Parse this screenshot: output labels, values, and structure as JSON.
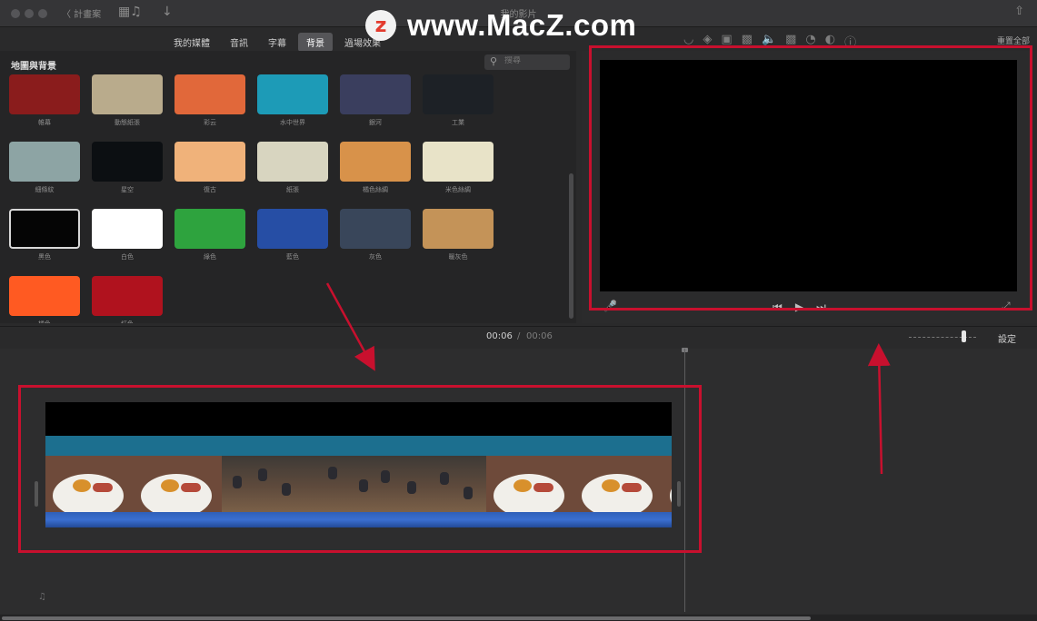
{
  "window": {
    "title": "我的影片",
    "back_label": "〈 計畫案"
  },
  "watermark": {
    "logo_letter": "z",
    "text": "www.MacZ.com"
  },
  "tabs": [
    {
      "label": "我的媒體",
      "active": false
    },
    {
      "label": "音訊",
      "active": false
    },
    {
      "label": "字幕",
      "active": false
    },
    {
      "label": "背景",
      "active": true
    },
    {
      "label": "過場效果",
      "active": false
    }
  ],
  "toolbar": {
    "reset_all": "重置全部"
  },
  "library": {
    "title": "地圖與背景",
    "search_placeholder": "搜尋",
    "items": [
      {
        "label": "帷幕",
        "color": "#8a1c1c"
      },
      {
        "label": "動態紙張",
        "color": "#b9ab8c"
      },
      {
        "label": "彩云",
        "color": "#e1683a"
      },
      {
        "label": "水中世界",
        "color": "#1d9bb7"
      },
      {
        "label": "銀河",
        "color": "#3a3e5e"
      },
      {
        "label": "工業",
        "color": "#1d2126"
      },
      {
        "label": "細條紋",
        "color": "#8da4a4"
      },
      {
        "label": "星空",
        "color": "#0c0f12"
      },
      {
        "label": "復古",
        "color": "#f0b27a"
      },
      {
        "label": "紙張",
        "color": "#d8d5c0"
      },
      {
        "label": "橘色絲綢",
        "color": "#d8924a"
      },
      {
        "label": "米色絲綢",
        "color": "#e8e3c8"
      },
      {
        "label": "黑色",
        "color": "#050505",
        "selected": true
      },
      {
        "label": "白色",
        "color": "#ffffff"
      },
      {
        "label": "綠色",
        "color": "#2ea33e"
      },
      {
        "label": "藍色",
        "color": "#264ea5"
      },
      {
        "label": "灰色",
        "color": "#39465a"
      },
      {
        "label": "暖灰色",
        "color": "#c49358"
      },
      {
        "label": "橘色",
        "color": "#ff5a22"
      },
      {
        "label": "紅色",
        "color": "#b0121e"
      }
    ]
  },
  "timeline": {
    "current_time": "00:06",
    "separator": "/",
    "total_time": "00:06",
    "settings_label": "設定"
  },
  "colors": {
    "annotation": "#c8102e",
    "clip_band": "#1c6f8f",
    "audio_wave": "#2f5fb8"
  },
  "icons": {
    "filmstrip": "film-music-icon",
    "download": "down-arrow-icon",
    "share": "share-icon",
    "search": "search-icon",
    "mic": "microphone-icon",
    "fullscreen": "expand-icon"
  }
}
